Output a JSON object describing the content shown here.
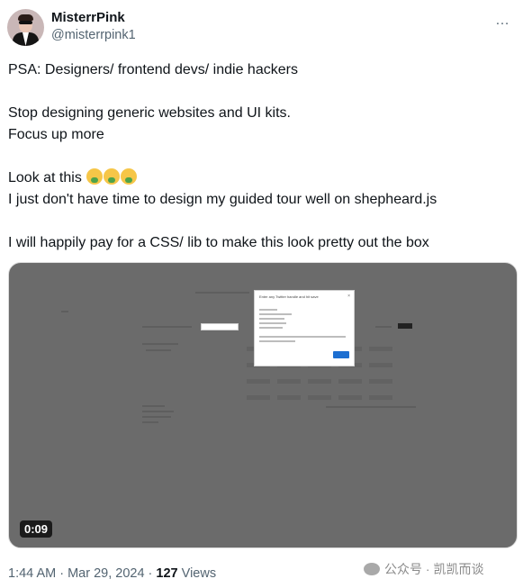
{
  "author": {
    "name": "MisterrPink",
    "handle": "@misterrpink1"
  },
  "more_icon": "…",
  "tweet_lines": [
    "PSA: Designers/ frontend devs/ indie hackers",
    "",
    "Stop designing generic websites and UI kits.",
    "Focus up more",
    "",
    "Look at this",
    "I just don't have time to design my guided tour well on shepheard.js",
    "",
    "I will happily pay for a CSS/ lib to make this look pretty out the box"
  ],
  "emoji": [
    "face-vomiting-emoji",
    "face-vomiting-emoji",
    "face-vomiting-emoji"
  ],
  "video": {
    "duration": "0:09",
    "modal_title": "Enter any Twitter handle and hit save",
    "modal_close": "×"
  },
  "meta": {
    "time": "1:44 AM · Mar 29, 2024 · ",
    "views_count": "127",
    "views_label": " Views"
  },
  "watermark": "公众号 · 凯凯而谈"
}
